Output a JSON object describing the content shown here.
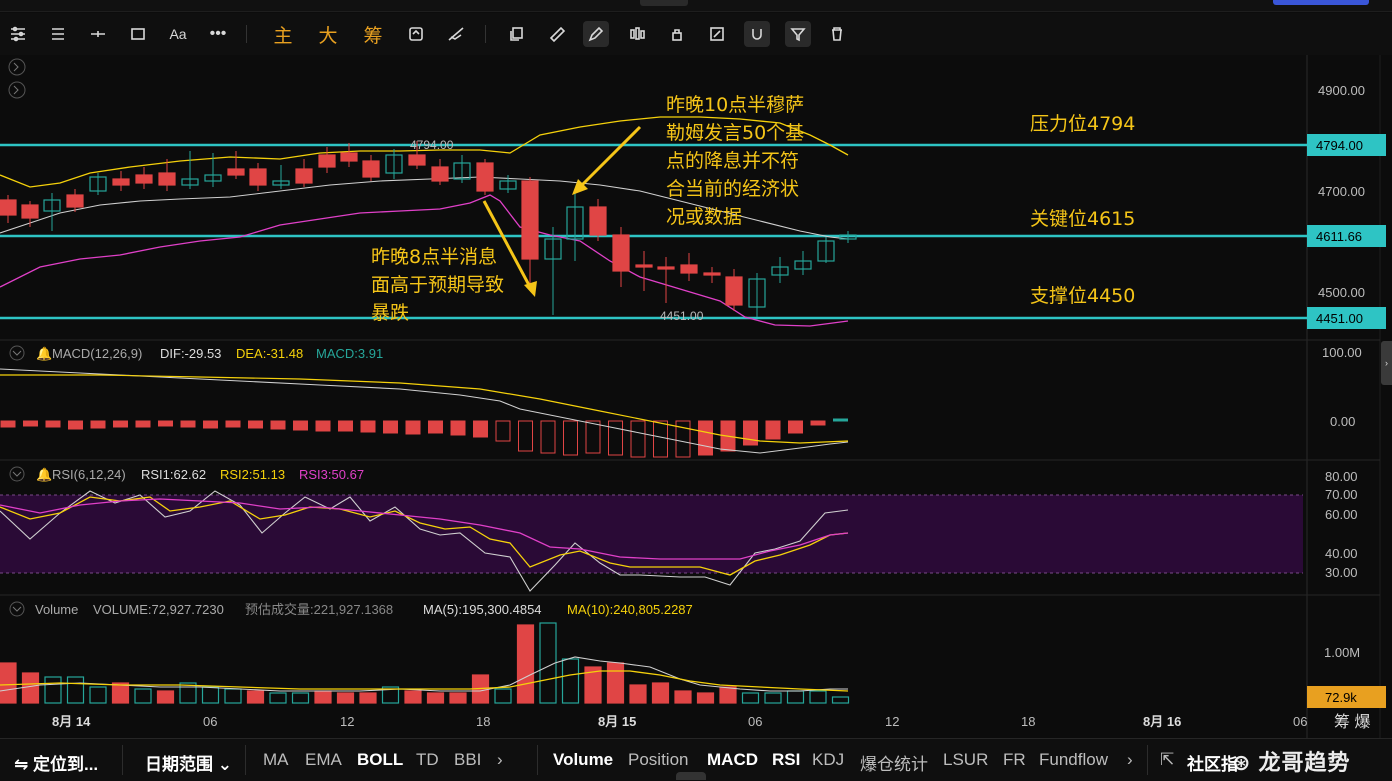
{
  "toolbar": {
    "cn_buttons": [
      "主",
      "大",
      "筹"
    ]
  },
  "price_axis": {
    "ticks": [
      "4900.00",
      "4794.00",
      "4700.00",
      "4611.66",
      "4500.00",
      "4451.00"
    ],
    "tag_price_4794": "4794.00",
    "tag_price_current": "4611.66",
    "tag_price_4451": "4451.00",
    "macd_ticks": [
      "100.00",
      "0.00"
    ],
    "rsi_ticks": [
      "80.00",
      "70.00",
      "60.00",
      "40.00",
      "30.00"
    ],
    "vol_ticks": [
      "1.00M"
    ],
    "vol_tag": "72.9k"
  },
  "time_axis": {
    "labels": [
      "8月 14",
      "06",
      "12",
      "18",
      "8月 15",
      "06",
      "12",
      "18",
      "8月 16",
      "06"
    ],
    "right_label": "筹  爆"
  },
  "chart_marks": {
    "hi_label": "4794.00",
    "lo_label": "4451.00"
  },
  "annotations": {
    "resistance": "压力位4794",
    "key_level": "关键位4615",
    "support": "支撑位4450",
    "note_upper": [
      "昨晚10点半穆萨",
      "勒姆发言50个基",
      "点的降息并不符",
      "合当前的经济状",
      "况或数据"
    ],
    "note_lower": [
      "昨晚8点半消息",
      "面高于预期导致",
      "暴跌"
    ]
  },
  "macd": {
    "name": "MACD(12,26,9)",
    "dif": "DIF:-29.53",
    "dea": "DEA:-31.48",
    "macd": "MACD:3.91"
  },
  "rsi": {
    "name": "RSI(6,12,24)",
    "rsi1": "RSI1:62.62",
    "rsi2": "RSI2:51.13",
    "rsi3": "RSI3:50.67"
  },
  "volume": {
    "name": "Volume",
    "volume": "VOLUME:72,927.7230",
    "est": "预估成交量:221,927.1368",
    "ma5": "MA(5):195,300.4854",
    "ma10": "MA(10):240,805.2287"
  },
  "bottom": {
    "locate": "定位到...",
    "date_range": "日期范围",
    "indicators_main": [
      "MA",
      "EMA",
      "BOLL",
      "TD",
      "BBI"
    ],
    "indicators_sub": [
      "Volume",
      "Position",
      "MACD",
      "RSI",
      "KDJ",
      "爆仓统计",
      "LSUR",
      "FR",
      "Fundflow"
    ],
    "community": "社区指",
    "watermark": "龙哥趋势"
  },
  "colors": {
    "up": "#26a69a",
    "down": "#e04545",
    "cyan": "#2ec4c4",
    "yellow": "#f5d10b",
    "magenta": "#e040c8",
    "annotation": "#f5c518",
    "accent": "#e8a020"
  }
}
